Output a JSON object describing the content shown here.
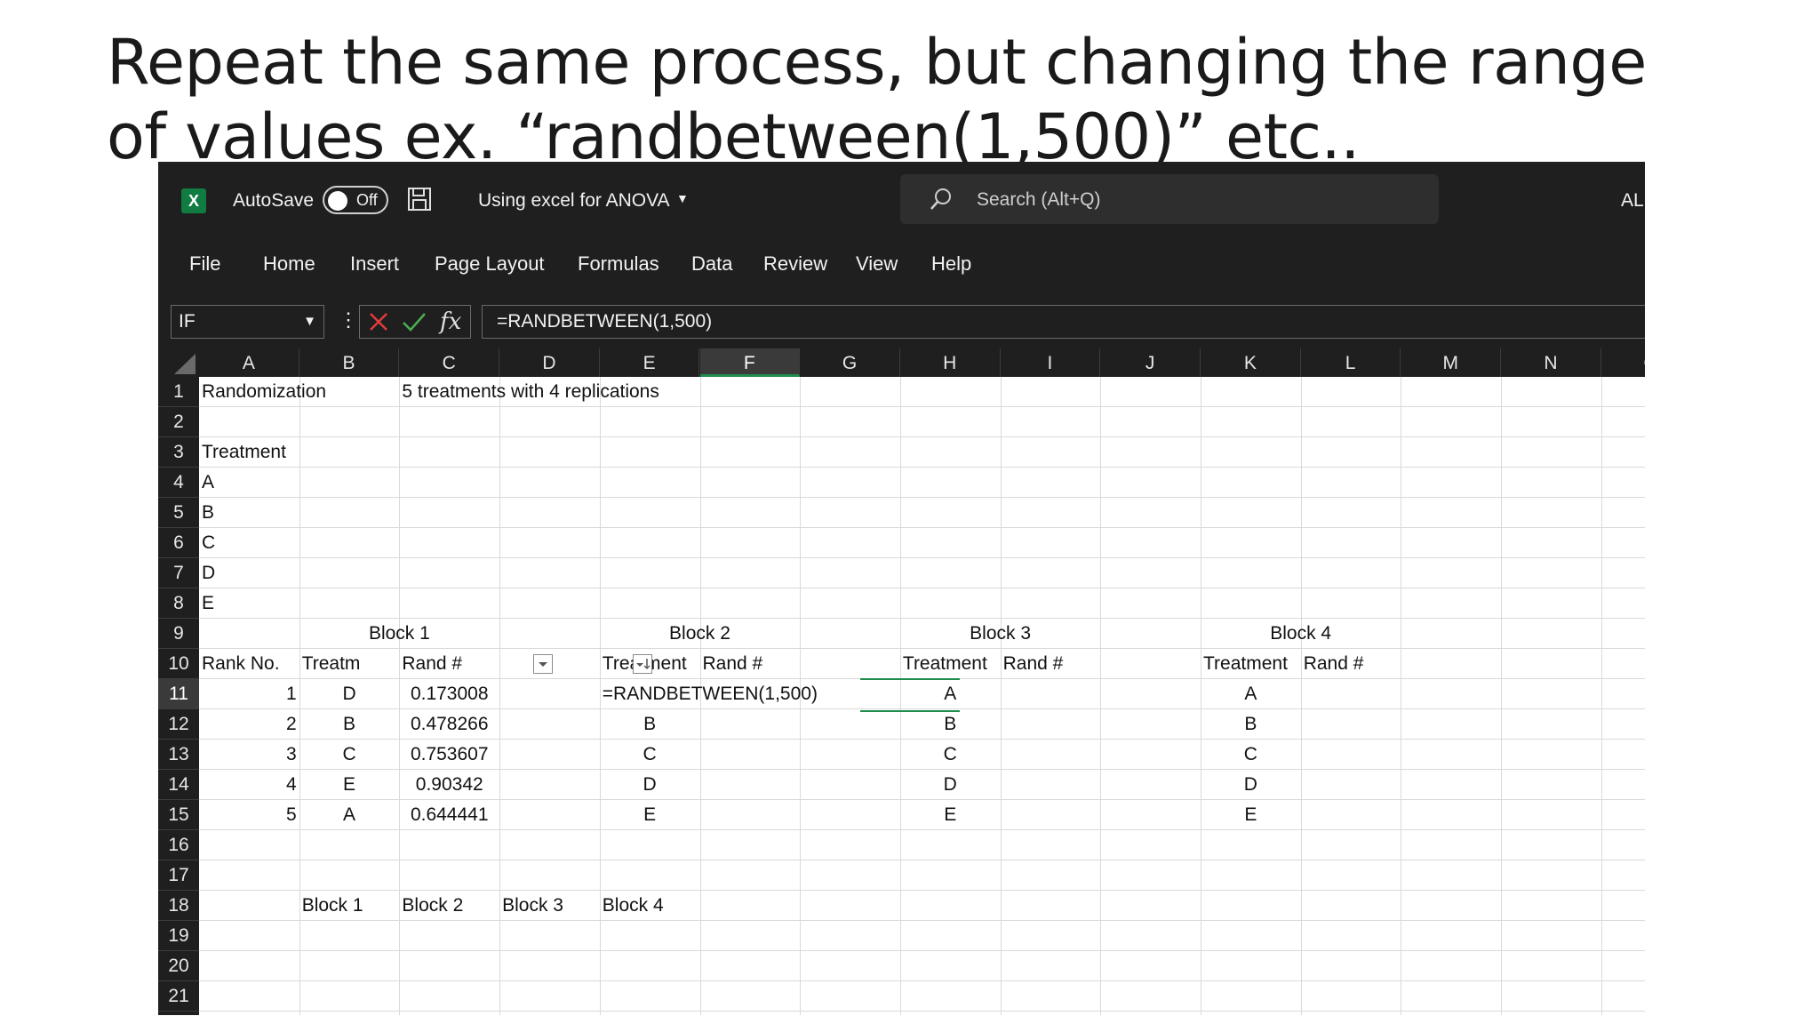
{
  "slide": {
    "title": "Repeat the same process, but changing the range of values ex. “randbetween(1,500)” etc.."
  },
  "window": {
    "logo": "X",
    "autosave_label": "AutoSave",
    "autosave_state": "Off",
    "doc_title": "Using excel for ANOVA",
    "search_placeholder": "Search (Alt+Q)",
    "user_initials": "AL",
    "icons": [
      "excel-logo-icon",
      "save-icon",
      "chevron-down-icon",
      "search-icon",
      "cancel-icon",
      "check-icon",
      "fx-icon"
    ]
  },
  "ribbon": {
    "tabs": [
      "File",
      "Home",
      "Insert",
      "Page Layout",
      "Formulas",
      "Data",
      "Review",
      "View",
      "Help"
    ]
  },
  "formula_bar": {
    "name_box": "IF",
    "formula": "=RANDBETWEEN(1,500)"
  },
  "grid": {
    "columns": [
      "A",
      "B",
      "C",
      "D",
      "E",
      "F",
      "G",
      "H",
      "I",
      "J",
      "K",
      "L",
      "M",
      "N",
      "O"
    ],
    "selected_column": "F",
    "rows": [
      1,
      2,
      3,
      4,
      5,
      6,
      7,
      8,
      9,
      10,
      11,
      12,
      13,
      14,
      15,
      16,
      17,
      18,
      19,
      20,
      21
    ],
    "selected_row": 11
  },
  "cells": {
    "A1": "Randomization",
    "C1": "5 treatments with 4 replications",
    "A3": "Treatment",
    "A4": "A",
    "A5": "B",
    "A6": "C",
    "A7": "D",
    "A8": "E",
    "B9": "Block 1",
    "E9": "Block 2",
    "H9": "Block 3",
    "K9": "Block 4",
    "A10": "Rank No.",
    "B10": "Treatm",
    "C10": "Rand #",
    "E10": "Treatment",
    "F10": "Rand #",
    "H10": "Treatment",
    "I10": "Rand #",
    "K10": "Treatment",
    "L10": "Rand #",
    "A11": "1",
    "A12": "2",
    "A13": "3",
    "A14": "4",
    "A15": "5",
    "B11": "D",
    "B12": "B",
    "B13": "C",
    "B14": "E",
    "B15": "A",
    "C11": "0.173008",
    "C12": "0.478266",
    "C13": "0.753607",
    "C14": "0.90342",
    "C15": "0.644441",
    "E11": "=RANDBETWEEN(1,500)",
    "E12": "B",
    "E13": "C",
    "E14": "D",
    "E15": "E",
    "H11": "A",
    "H12": "B",
    "H13": "C",
    "H14": "D",
    "H15": "E",
    "K11": "A",
    "K12": "B",
    "K13": "C",
    "K14": "D",
    "K15": "E",
    "B18": "Block 1",
    "C18": "Block 2",
    "D18": "Block 3",
    "E18": "Block 4"
  }
}
